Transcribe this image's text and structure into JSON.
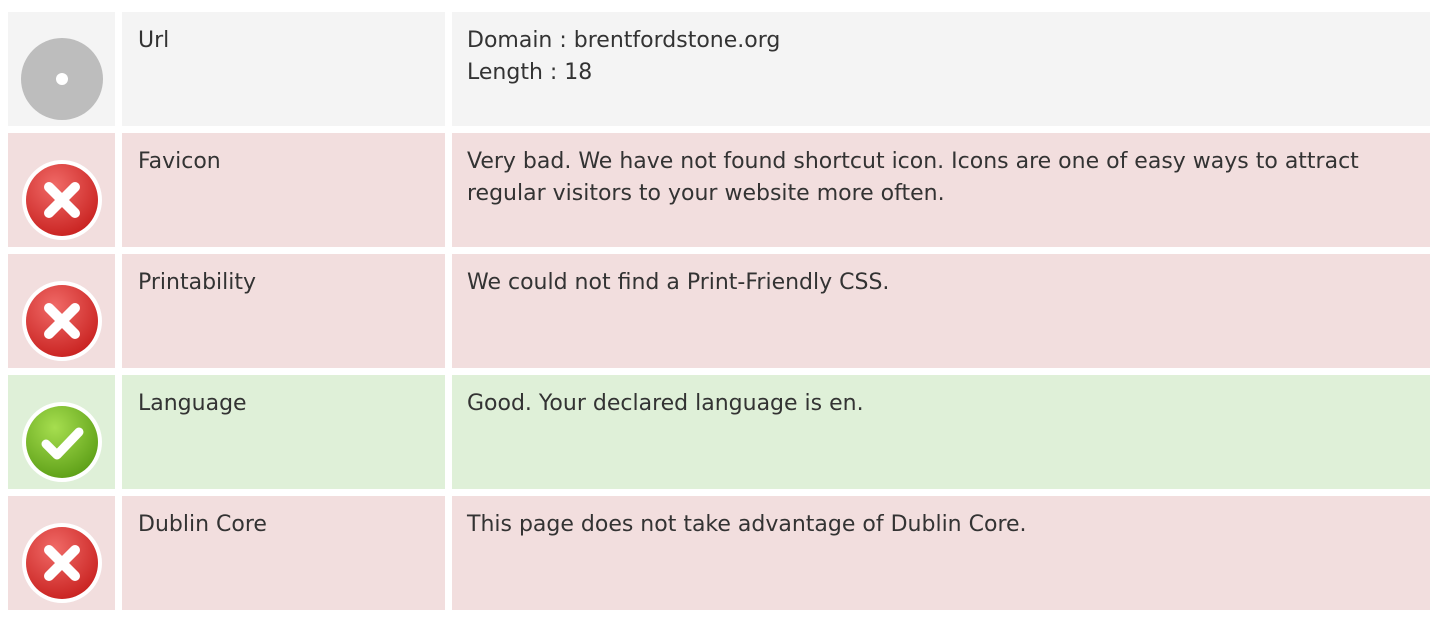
{
  "rows": [
    {
      "status": "neutral",
      "icon": "neutral-dot-icon",
      "label": "Url",
      "lines": [
        "Domain : brentfordstone.org",
        "Length : 18"
      ]
    },
    {
      "status": "bad",
      "icon": "error-x-icon",
      "label": "Favicon",
      "lines": [
        "Very bad. We have not found shortcut icon. Icons are one of easy ways to attract regular visitors to your website more often."
      ]
    },
    {
      "status": "bad",
      "icon": "error-x-icon",
      "label": "Printability",
      "lines": [
        "We could not find a Print-Friendly CSS."
      ]
    },
    {
      "status": "good",
      "icon": "success-check-icon",
      "label": "Language",
      "lines": [
        "Good. Your declared language is en."
      ]
    },
    {
      "status": "bad",
      "icon": "error-x-icon",
      "label": "Dublin Core",
      "lines": [
        "This page does not take advantage of Dublin Core."
      ]
    }
  ],
  "colors": {
    "neutral_bg": "#f4f4f4",
    "bad_bg": "#f2dede",
    "good_bg": "#dff0d8",
    "error_icon": "#d9302f",
    "success_icon": "#6fb31f",
    "neutral_icon": "#bdbdbd"
  }
}
